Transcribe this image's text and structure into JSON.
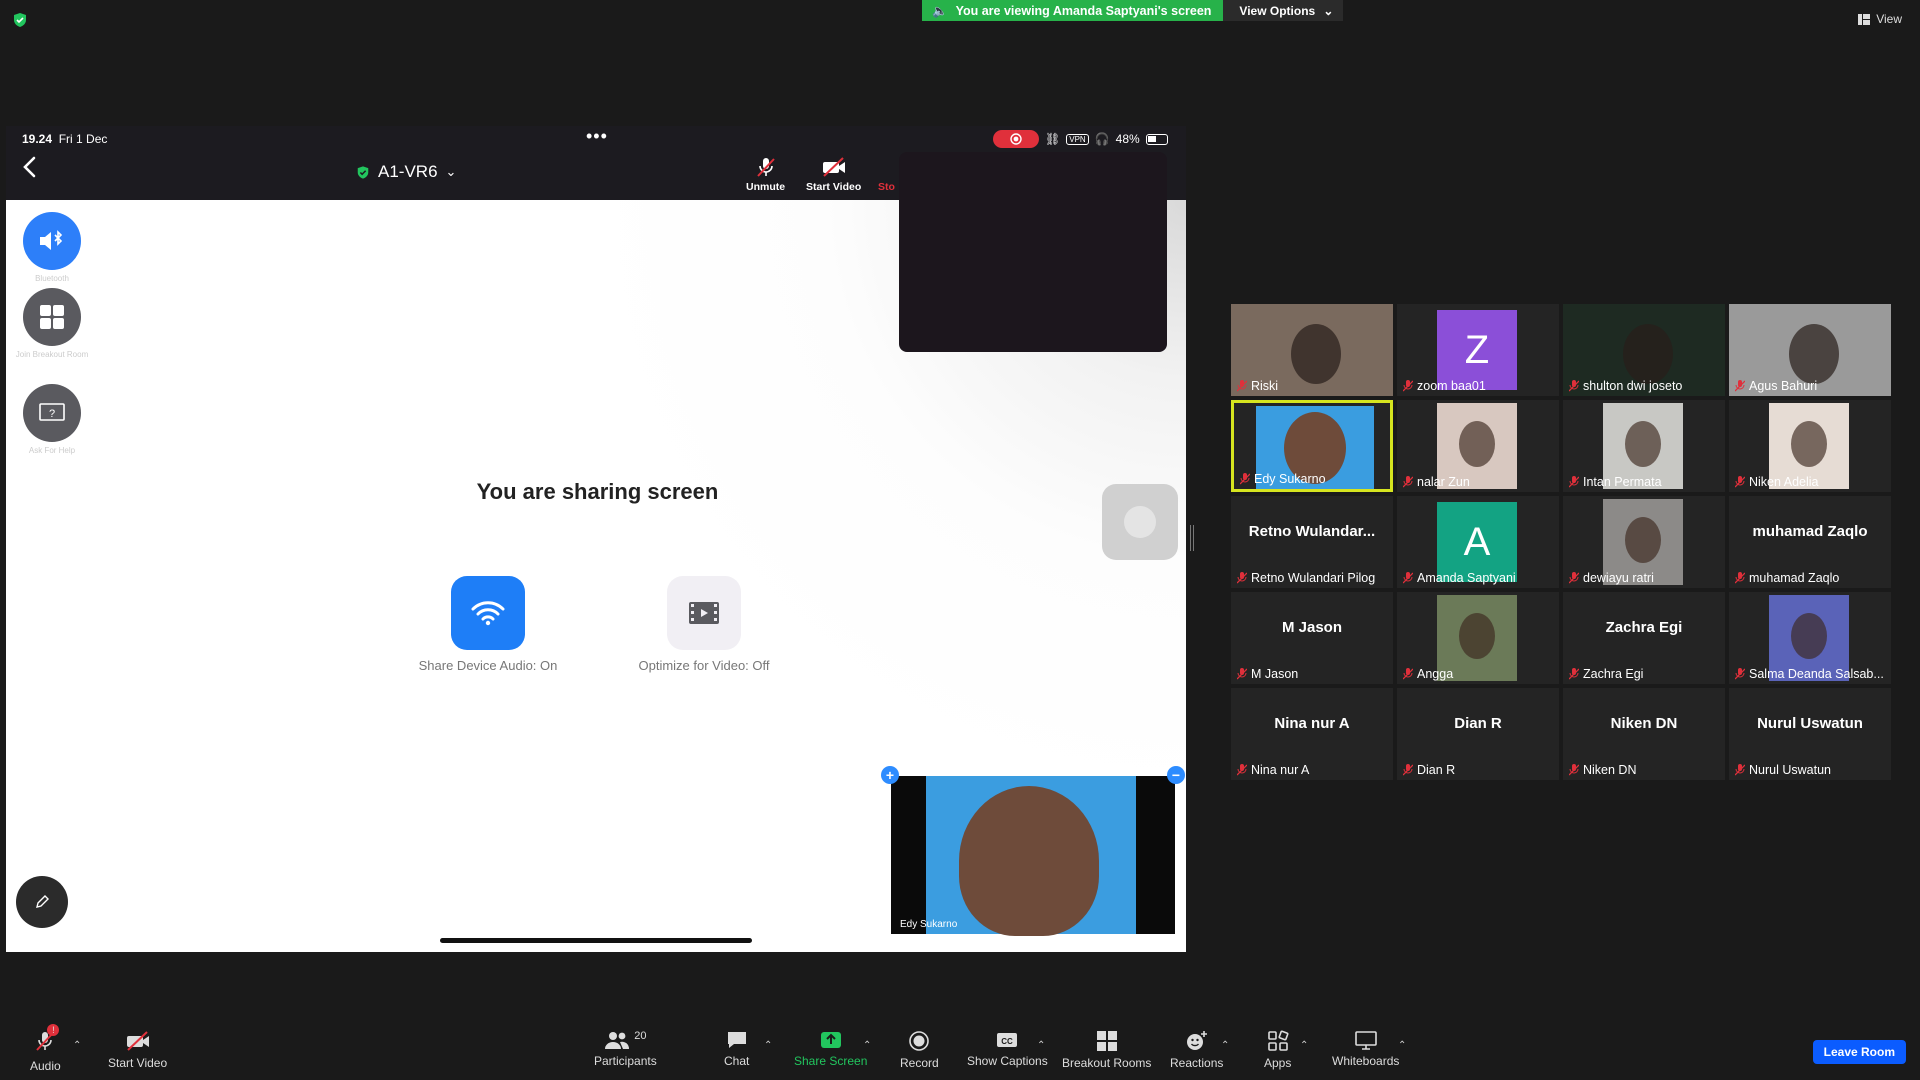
{
  "banner": {
    "viewing_text": "You are viewing Amanda Saptyani's screen",
    "view_options": "View Options"
  },
  "view_label": "View",
  "ipad": {
    "time": "19.24",
    "date": "Fri 1 Dec",
    "battery": "48%",
    "vpn": "VPN",
    "meeting_title": "A1-VR6",
    "toolbar": {
      "unmute": "Unmute",
      "start_video": "Start Video",
      "stop_partial": "Sto"
    },
    "side": {
      "bluetooth": "Bluetooth",
      "breakout": "Join Breakout Room",
      "help": "Ask For Help"
    },
    "sharing_title": "You are sharing screen",
    "share_audio": "Share Device Audio: On",
    "optimize_video": "Optimize for Video: Off",
    "pip_name": "Edy Sukarno"
  },
  "participants": [
    {
      "name": "Riski",
      "big": "",
      "type": "photo",
      "color": "#7a6a5e"
    },
    {
      "name": "zoom baa01",
      "big": "Z",
      "type": "avatar",
      "color": "#8b4fd8"
    },
    {
      "name": "shulton dwi joseto",
      "big": "",
      "type": "photo",
      "color": "#1e2a22"
    },
    {
      "name": "Agus Bahuri",
      "big": "",
      "type": "photo",
      "color": "#9a9a9a"
    },
    {
      "name": "Edy Sukarno",
      "big": "",
      "type": "photo-active",
      "color": "#3a9de0"
    },
    {
      "name": "nalar Zun",
      "big": "",
      "type": "photo",
      "color": "#d8c8c0"
    },
    {
      "name": "Intan Permata",
      "big": "",
      "type": "photo",
      "color": "#c8c8c4"
    },
    {
      "name": "Niken Adelia",
      "big": "",
      "type": "photo",
      "color": "#e6dcd4"
    },
    {
      "name": "Retno Wulandari Pilog",
      "big": "Retno  Wulandar...",
      "type": "text"
    },
    {
      "name": "Amanda Saptyani",
      "big": "A",
      "type": "avatar",
      "color": "#13a383"
    },
    {
      "name": "dewiayu ratri",
      "big": "",
      "type": "photo",
      "color": "#8c8a88"
    },
    {
      "name": "muhamad Zaqlo",
      "big": "muhamad Zaqlo",
      "type": "text"
    },
    {
      "name": "M Jason",
      "big": "M Jason",
      "type": "text"
    },
    {
      "name": "Angga",
      "big": "",
      "type": "photo",
      "color": "#6b7a58"
    },
    {
      "name": "Zachra Egi",
      "big": "Zachra Egi",
      "type": "text"
    },
    {
      "name": "Salma Deanda Salsab...",
      "big": "",
      "type": "photo",
      "color": "#5a63b8"
    },
    {
      "name": "Nina nur A",
      "big": "Nina nur A",
      "type": "text"
    },
    {
      "name": "Dian R",
      "big": "Dian R",
      "type": "text"
    },
    {
      "name": "Niken DN",
      "big": "Niken DN",
      "type": "text"
    },
    {
      "name": "Nurul Uswatun",
      "big": "Nurul Uswatun",
      "type": "text"
    }
  ],
  "bottom": {
    "audio": "Audio",
    "start_video": "Start Video",
    "participants": "Participants",
    "participants_count": "20",
    "chat": "Chat",
    "share_screen": "Share Screen",
    "record": "Record",
    "show_captions": "Show Captions",
    "breakout_rooms": "Breakout Rooms",
    "reactions": "Reactions",
    "apps": "Apps",
    "whiteboards": "Whiteboards",
    "leave_room": "Leave Room",
    "audio_badge": "!"
  },
  "colors": {
    "accent": "#2d8cff",
    "share_green": "#22c55e",
    "active_speaker": "#d6e51f",
    "leave": "#0b5cff"
  }
}
